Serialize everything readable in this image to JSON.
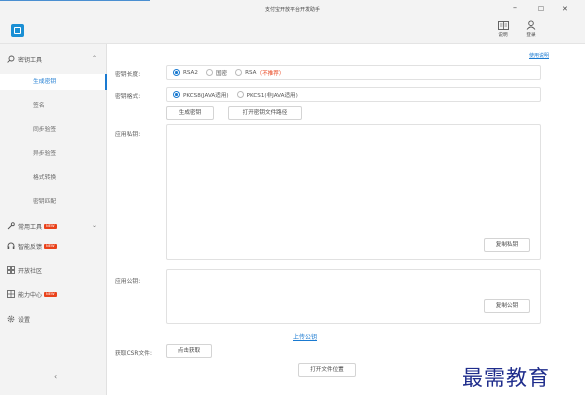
{
  "window": {
    "title": "支付宝开放平台开发助手",
    "minimize": "–",
    "maximize": "☐",
    "close": "✕"
  },
  "toolbar": {
    "docs_label": "说明",
    "login_label": "登录"
  },
  "sidebar": {
    "group_key_tools": "密钥工具",
    "sub_items": [
      "生成密钥",
      "签名",
      "同步验签",
      "异步验签",
      "格式转换",
      "密钥匹配"
    ],
    "group_common_tools": "常用工具",
    "group_feedback": "智能反馈",
    "group_community": "开放社区",
    "group_capability": "能力中心",
    "group_settings": "设置",
    "new_badge": "NEW",
    "collapse": "‹"
  },
  "main": {
    "help_link": "使用说明",
    "key_length": {
      "label": "密钥长度:",
      "options": [
        "RSA2",
        "国密",
        "RSA"
      ],
      "warning": "（不推荐）",
      "selected": "RSA2"
    },
    "key_format": {
      "label": "密钥格式:",
      "options": [
        "PKCS8(JAVA适用)",
        "PKCS1(非JAVA适用)"
      ],
      "selected": "PKCS8(JAVA适用)"
    },
    "generate_button": "生成密钥",
    "open_path_button": "打开密钥文件路径",
    "private_key": {
      "label": "应用私钥:",
      "value": "",
      "copy_button": "复制私钥"
    },
    "public_key": {
      "label": "应用公钥:",
      "value": "",
      "copy_button": "复制公钥"
    },
    "upload_link": "上传公钥",
    "csr": {
      "label": "获取CSR文件:",
      "button": "点击获取"
    },
    "open_file_location_button": "打开文件位置"
  },
  "watermark": "最需教育"
}
